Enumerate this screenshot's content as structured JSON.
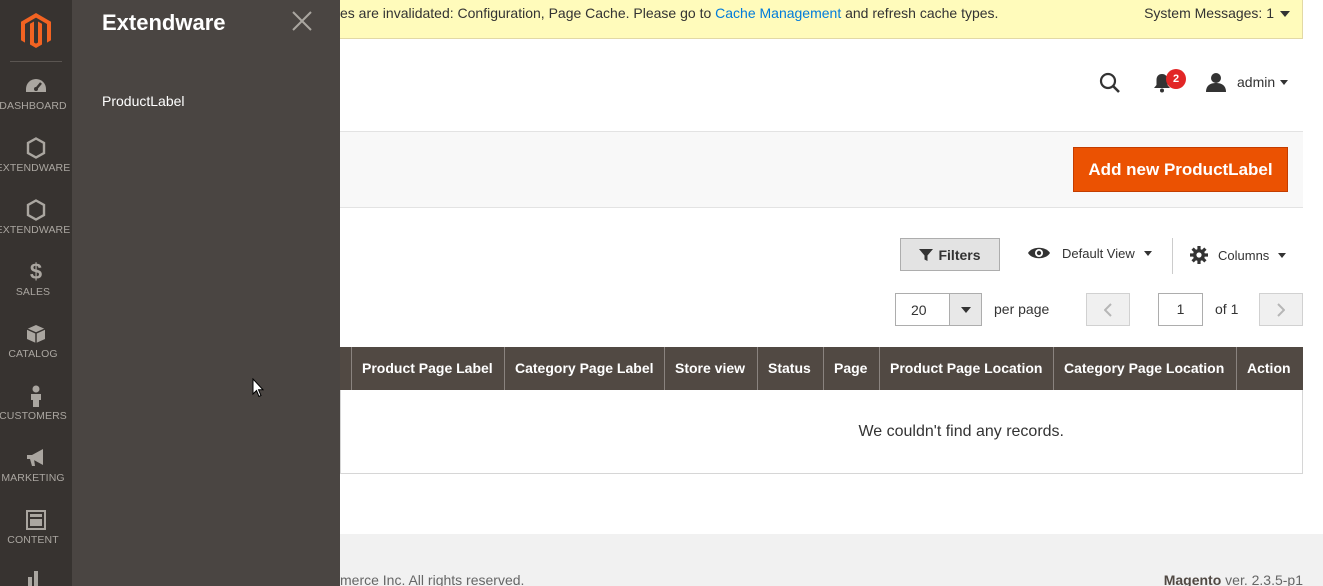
{
  "nav": {
    "items": [
      {
        "label": "DASHBOARD",
        "icon": "dashboard-icon"
      },
      {
        "label": "EXTENDWARE",
        "icon": "hexagon-icon"
      },
      {
        "label": "EXTENDWARE",
        "icon": "hexagon-icon"
      },
      {
        "label": "SALES",
        "icon": "dollar-icon"
      },
      {
        "label": "CATALOG",
        "icon": "box-icon"
      },
      {
        "label": "CUSTOMERS",
        "icon": "person-icon"
      },
      {
        "label": "MARKETING",
        "icon": "megaphone-icon"
      },
      {
        "label": "CONTENT",
        "icon": "layout-icon"
      }
    ]
  },
  "flyout": {
    "title": "Extendware",
    "links": [
      "ProductLabel"
    ]
  },
  "system_message": {
    "prefix": "es are invalidated: Configuration, Page Cache. Please go to ",
    "link": "Cache Management",
    "suffix": " and refresh cache types.",
    "count_label": "System Messages: 1"
  },
  "header": {
    "notification_count": "2",
    "user_name": "admin"
  },
  "actions": {
    "add_button": "Add new ProductLabel"
  },
  "grid_controls": {
    "filters": "Filters",
    "view": "Default View",
    "columns": "Columns",
    "per_page_value": "20",
    "per_page_label": "per page",
    "current_page": "1",
    "total_pages_label": "of 1"
  },
  "table": {
    "columns": [
      "Product Page Label",
      "Category Page Label",
      "Store view",
      "Status",
      "Page",
      "Product Page Location",
      "Category Page Location",
      "Action"
    ],
    "empty_message": "We couldn't find any records."
  },
  "footer": {
    "copyright": "merce Inc. All rights reserved.",
    "brand": "Magento",
    "version": " ver. 2.3.5-p1"
  },
  "colors": {
    "nav_bg": "#373330",
    "flyout_bg": "#4a4542",
    "accent": "#eb5202",
    "grid_header": "#514943",
    "message_bg": "#fffbbb"
  }
}
